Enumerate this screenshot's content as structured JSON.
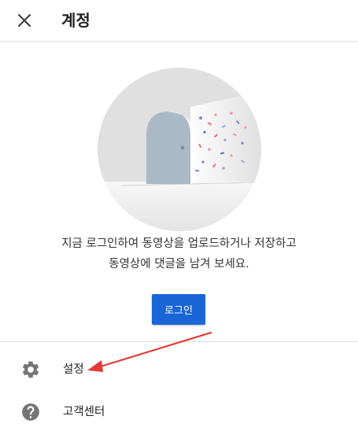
{
  "header": {
    "title": "계정",
    "close_icon": "close-icon"
  },
  "illustration": {
    "icon": "door-confetti-illustration"
  },
  "message": {
    "line1": "지금 로그인하여 동영상을 업로드하거나 저장하고",
    "line2": "동영상에 댓글을 남겨 보세요."
  },
  "login": {
    "label": "로그인",
    "color": "#1a66d6"
  },
  "menu": {
    "items": [
      {
        "label": "설정",
        "icon": "gear-icon"
      },
      {
        "label": "고객센터",
        "icon": "help-icon"
      }
    ]
  },
  "annotation": {
    "color": "#e53935",
    "icon": "red-arrow-annotation"
  }
}
